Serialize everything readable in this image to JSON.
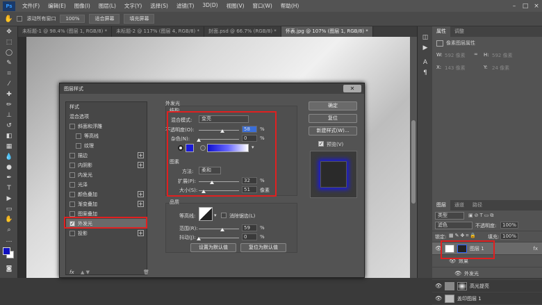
{
  "menu": [
    "文件(F)",
    "编辑(E)",
    "图像(I)",
    "图层(L)",
    "文字(Y)",
    "选择(S)",
    "滤镜(T)",
    "3D(D)",
    "视图(V)",
    "窗口(W)",
    "帮助(H)"
  ],
  "options": {
    "scroll_all": "滚动所有窗口",
    "zoom": "100%",
    "fit_screen": "适合屏幕",
    "fill_screen": "填充屏幕"
  },
  "tabs": [
    "未标题-1 @ 98.4% (图层 1, RGB/8) *",
    "未标题-2 @ 117% (图层 4, RGB/8) *",
    "封面.psd @ 66.7% (RGB/8) *",
    "怀表.jpg @ 107% (图层 1, RGB/8) *"
  ],
  "right_panel": {
    "tab_props": "属性",
    "tab_adjust": "调整",
    "pixel_layer": "像素图层属性",
    "w": "W:",
    "w_val": "592 像素",
    "h": "H:",
    "h_val": "592 像素",
    "x": "X:",
    "x_val": "143 像素",
    "y": "Y:",
    "y_val": "24 像素"
  },
  "layers_panel": {
    "tabs": [
      "图层",
      "通道",
      "路径"
    ],
    "kind": "类型",
    "mode": "滤色",
    "opacity_label": "不透明度:",
    "opacity": "100%",
    "lock": "锁定:",
    "fill_label": "填充:",
    "fill": "100%",
    "rows": [
      {
        "name": "图层 1",
        "fx": "fx"
      },
      {
        "name": "效果"
      },
      {
        "name": "外发光"
      },
      {
        "name": "高光提亮"
      },
      {
        "name": "盖印图层 1"
      }
    ]
  },
  "dialog": {
    "title": "图层样式",
    "list": [
      {
        "label": "样式",
        "check": false,
        "plus": false,
        "indent": false
      },
      {
        "label": "混合选项",
        "check": false,
        "plus": false,
        "indent": false
      },
      {
        "label": "斜面和浮雕",
        "check": true,
        "plus": false,
        "indent": false
      },
      {
        "label": "等高线",
        "check": true,
        "plus": false,
        "indent": true
      },
      {
        "label": "纹理",
        "check": true,
        "plus": false,
        "indent": true
      },
      {
        "label": "描边",
        "check": true,
        "plus": true,
        "indent": false
      },
      {
        "label": "内阴影",
        "check": true,
        "plus": true,
        "indent": false
      },
      {
        "label": "内发光",
        "check": true,
        "plus": false,
        "indent": false
      },
      {
        "label": "光泽",
        "check": true,
        "plus": false,
        "indent": false
      },
      {
        "label": "颜色叠加",
        "check": true,
        "plus": true,
        "indent": false
      },
      {
        "label": "渐变叠加",
        "check": true,
        "plus": true,
        "indent": false
      },
      {
        "label": "图案叠加",
        "check": true,
        "plus": false,
        "indent": false
      },
      {
        "label": "外发光",
        "check": true,
        "plus": false,
        "indent": false,
        "checked": true
      },
      {
        "label": "投影",
        "check": true,
        "plus": true,
        "indent": false
      }
    ],
    "fx": "fx",
    "outer_glow": "外发光",
    "structure": "结构",
    "blend_mode_label": "混合模式:",
    "blend_mode": "变亮",
    "opacity_label": "不透明度(O):",
    "opacity": "58",
    "opacity_value": 58,
    "noise_label": "杂色(N):",
    "noise": "0",
    "noise_value": 0,
    "percent": "%",
    "elements": "图素",
    "method_label": "方法:",
    "method": "柔和",
    "spread_label": "扩展(P):",
    "spread": "32",
    "spread_value": 32,
    "size_label": "大小(S):",
    "size": "51",
    "size_value": 51,
    "px_unit": "像素",
    "quality": "品质",
    "contour_label": "等高线:",
    "antialias": "消除锯齿(L)",
    "range_label": "范围(R):",
    "range": "59",
    "range_value": 59,
    "jitter_label": "抖动(J):",
    "jitter": "0",
    "jitter_value": 0,
    "set_default": "设置为默认值",
    "reset_default": "复位为默认值",
    "ok": "确定",
    "reset": "复位",
    "new_style": "新建样式(W)...",
    "preview": "预览(V)",
    "glow_color": "#1a1ad8"
  }
}
